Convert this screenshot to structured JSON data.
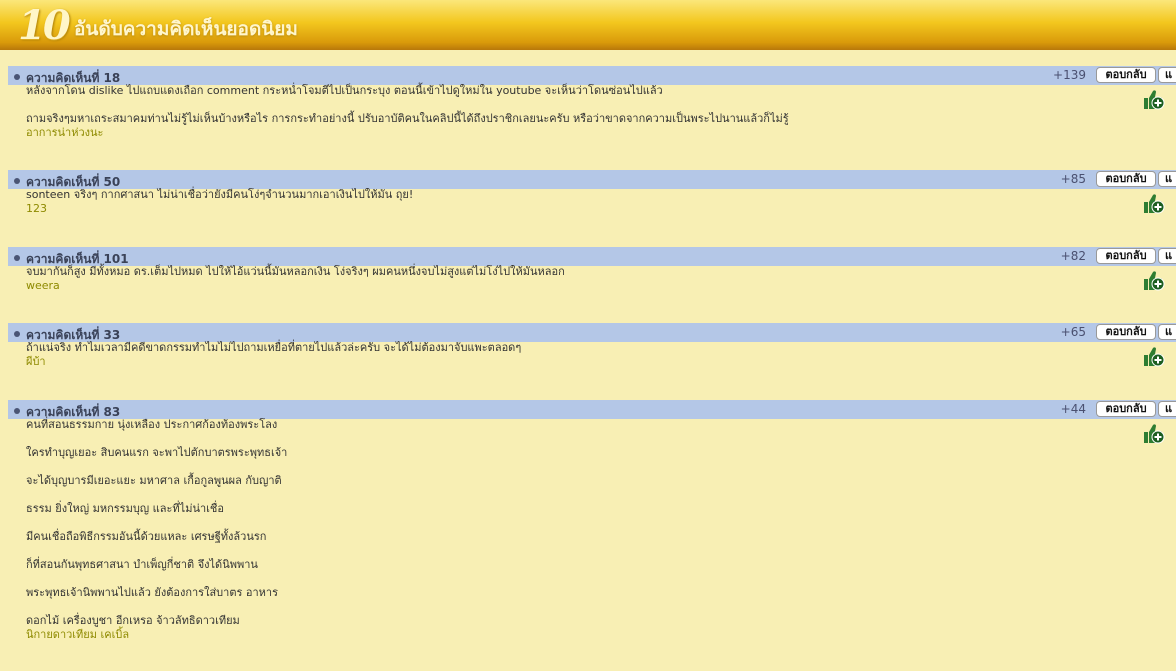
{
  "header": {
    "number": "10",
    "title": "อันดับความคิดเห็นยอดนิยม"
  },
  "colors": {
    "background": "#f8efb4",
    "bar": "#b4c7e7",
    "author": "#8e8a00",
    "like_icon": "#2e7d32"
  },
  "comments": [
    {
      "label": "ความคิดเห็นที่ 18",
      "score": "+139",
      "reply": "ตอบกลับ",
      "more": "แ",
      "lines": [
        "หลังจากโดน dislike ไปแถบแดงเถือก comment กระหน่ำโจมตีไปเป็นกระบุง ตอนนี้เข้าไปดูใหม่ใน youtube จะเห็นว่าโดนซ่อนไปแล้ว",
        "ถามจริงๆมหาเถระสมาคมท่านไม่รู้ไม่เห็นบ้างหรือไร การกระทำอย่างนี้ ปรับอาบัติคนในคลิปนี้ได้ถึงปราชิกเลยนะครับ หรือว่าขาดจากความเป็นพระไปนานแล้วก็ไม่รู้"
      ],
      "author": "อาการน่าห่วงนะ"
    },
    {
      "label": "ความคิดเห็นที่ 50",
      "score": "+85",
      "reply": "ตอบกลับ",
      "more": "แ",
      "lines": [
        "sonteen จริงๆ กากศาสนา ไม่น่าเชื่อว่ายังมีคนโง่ๆจำนวนมากเอาเงินไปให้มัน ถุย!"
      ],
      "author": "123"
    },
    {
      "label": "ความคิดเห็นที่ 101",
      "score": "+82",
      "reply": "ตอบกลับ",
      "more": "แ",
      "lines": [
        "จบมากันก็สูง มีทั้งหมอ ดร.เต็มไปหมด ไปให้ไอ้แว่นนี้มันหลอกเงิน โง่จริงๆ ผมคนหนึ่งจบไม่สูงแต่ไม่โง่ไปให้มันหลอก"
      ],
      "author": "weera"
    },
    {
      "label": "ความคิดเห็นที่ 33",
      "score": "+65",
      "reply": "ตอบกลับ",
      "more": "แ",
      "lines": [
        "ถ้าแน่จริง ทำไมเวลามีคดีขาดกรรมทำไมไม่ไปถามเหยื่อที่ตายไปแล้วล่ะครับ จะได้ไม่ต้องมาจับแพะตลอดๆ"
      ],
      "author": "ผีบ้า"
    },
    {
      "label": "ความคิดเห็นที่ 83",
      "score": "+44",
      "reply": "ตอบกลับ",
      "more": "แ",
      "lines": [
        "คนที่สอนธรรมกาย นุ่งเหลือง ประกาศก้องท้องพระโลง",
        "ใครทำบุญเยอะ สิบคนแรก จะพาไปตักบาตรพระพุทธเจ้า",
        "จะได้บุญบารมีเยอะแยะ มหาศาล เกื้อกูลพูนผล กับญาติ",
        "ธรรม ยิ่งใหญ่ มหกรรมบุญ และที่ไม่น่าเชื่อ",
        "มีคนเชื่อถือพิธีกรรมอันนี้ด้วยแหละ เศรษฐีทั้งล้วนรก",
        "ก็ที่สอนกันพุทธศาสนา บำเพ็ญกี่ชาติ จึงได้นิพพาน",
        "พระพุทธเจ้านิพพานไปแล้ว ยังต้องการใส่บาตร อาหาร",
        "ดอกไม้ เครื่องบูชา อีกเหรอ จ้าวลัทธิดาวเทียม"
      ],
      "author": "นิกายดาวเทียม เคเบิ้ล"
    }
  ]
}
